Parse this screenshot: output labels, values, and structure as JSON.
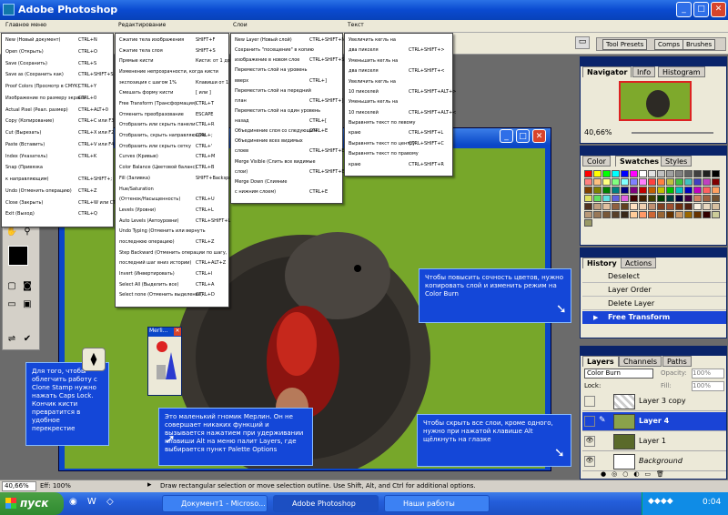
{
  "window": {
    "title": "Adobe Photoshop"
  },
  "menu_labels": [
    "Главное меню",
    "Редактирование",
    "Слои",
    "Текст"
  ],
  "palette_well": {
    "tabs": [
      "Tool Presets",
      "Comps",
      "Brushes"
    ]
  },
  "menu_file": {
    "rows": [
      {
        "label": "New (Новый документ)",
        "shortcut": "CTRL+N"
      },
      {
        "label": "Open (Открыть)",
        "shortcut": "CTRL+O"
      },
      {
        "label": "Save (Сохранить)",
        "shortcut": "CTRL+S"
      },
      {
        "label": "Save as (Сохранить как)",
        "shortcut": "CTRL+SHIFT+S"
      },
      {
        "label": "Proof Colors (Просмотр в CMYK)",
        "shortcut": "CTRL+Y"
      },
      {
        "label": "Изображение по размеру экрана",
        "shortcut": "CTRL+0"
      },
      {
        "label": "Actual Pixel (Реал. размер)",
        "shortcut": "CTRL+ALT+0"
      },
      {
        "label": "Copy (Копирование)",
        "shortcut": "CTRL+С или F3"
      },
      {
        "label": "Cut (Вырезать)",
        "shortcut": "CTRL+X или F2"
      },
      {
        "label": "Paste (Вставить)",
        "shortcut": "CTRL+V или F4"
      },
      {
        "label": "Index (Указатель)",
        "shortcut": "CTRL+K"
      },
      {
        "label": "Snap (Привязка",
        "shortcut": ""
      },
      {
        "label": "к направляющим)",
        "shortcut": "CTRL+SHIFT+;"
      },
      {
        "label": "Undo (Отменить операцию)",
        "shortcut": "CTRL+Z"
      },
      {
        "label": "Close (Закрыть)",
        "shortcut": "CTRL+W или CTRL+F4"
      },
      {
        "label": "Exit (Выход)",
        "shortcut": "CTRL+Q"
      }
    ]
  },
  "menu_edit": {
    "rows": [
      {
        "label": "Сжатие тела изображения",
        "shortcut": "SHIFT+F"
      },
      {
        "label": "Сжатие тела слоя",
        "shortcut": "SHIFT+S"
      },
      {
        "label": "Прямые кисти",
        "shortcut": "Кисти: от 1 до 9 + цифры"
      },
      {
        "label": "Изменение непрозрачности, когда кисти",
        "shortcut": ""
      },
      {
        "label": "экспозиция с шагом 1%",
        "shortcut": "Клавиши от 1 до 0"
      },
      {
        "label": "Смешать форму кисти",
        "shortcut": "[ или ]"
      },
      {
        "label": "Free Transform (Трансформация)",
        "shortcut": "CTRL+T"
      },
      {
        "label": "Отменить преобразование",
        "shortcut": "ESCAPE"
      },
      {
        "label": "Отобразить или скрыть панели",
        "shortcut": "CTRL+R"
      },
      {
        "label": "Отобразить, скрыть направляющие",
        "shortcut": "CTRL+;"
      },
      {
        "label": "Отобразить или скрыть сетку",
        "shortcut": "CTRL+'"
      },
      {
        "label": "Curves (Кривые)",
        "shortcut": "CTRL+M"
      },
      {
        "label": "Color Balance (Цветовой баланс)",
        "shortcut": "CTRL+B"
      },
      {
        "label": "Fill (Заливка)",
        "shortcut": "SHIFT+Backspace"
      },
      {
        "label": "Hue/Saturation",
        "shortcut": ""
      },
      {
        "label": "(Оттенок/Насыщенность)",
        "shortcut": "CTRL+U"
      },
      {
        "label": "Levels (Уровни)",
        "shortcut": "CTRL+L"
      },
      {
        "label": "Auto Levels (Автоуровни)",
        "shortcut": "CTRL+SHIFT+L"
      },
      {
        "label": "Undo Typing (Отменить или вернуть",
        "shortcut": ""
      },
      {
        "label": "последнюю операцию)",
        "shortcut": "CTRL+Z"
      },
      {
        "label": "Step Backward (Отменить операции по шагу,",
        "shortcut": ""
      },
      {
        "label": "последний шаг вниз истории)",
        "shortcut": "CTRL+ALT+Z"
      },
      {
        "label": "Invert (Инвертировать)",
        "shortcut": "CTRL+I"
      },
      {
        "label": "Select All (Выделить все)",
        "shortcut": "CTRL+A"
      },
      {
        "label": "Select none (Отменить выделение)",
        "shortcut": "CTRL+D"
      }
    ]
  },
  "menu_layer": {
    "rows": [
      {
        "label": "New Layer (Новый слой)",
        "shortcut": "CTRL+SHIFT+N"
      },
      {
        "label": "Сохранить \"посещение\" в копию",
        "shortcut": ""
      },
      {
        "label": "изображение в новом слое",
        "shortcut": "CTRL+SHIFT+S"
      },
      {
        "label": "Переместить слой на уровень",
        "shortcut": ""
      },
      {
        "label": "вверх",
        "shortcut": "CTRL+]"
      },
      {
        "label": "Переместить слой на передний",
        "shortcut": ""
      },
      {
        "label": "план",
        "shortcut": "CTRL+SHIFT+]"
      },
      {
        "label": "Переместить слой на один уровень",
        "shortcut": ""
      },
      {
        "label": "назад",
        "shortcut": "CTRL+["
      },
      {
        "label": "Объединение слоя со следующим",
        "shortcut": "CTRL+E"
      },
      {
        "label": "Объединение всех видимых",
        "shortcut": ""
      },
      {
        "label": "слоев",
        "shortcut": "CTRL+SHIFT+E"
      },
      {
        "label": "Merge Visible (Слить все видимые",
        "shortcut": ""
      },
      {
        "label": "слои)",
        "shortcut": "CTRL+SHIFT+E"
      },
      {
        "label": "Merge Down (Слияние",
        "shortcut": ""
      },
      {
        "label": "с нижним слоем)",
        "shortcut": "CTRL+E"
      }
    ]
  },
  "menu_text": {
    "rows": [
      {
        "label": "Увеличить кегль на",
        "shortcut": ""
      },
      {
        "label": "два пикселя",
        "shortcut": "CTRL+SHIFT+>"
      },
      {
        "label": "Уменьшить кегль на",
        "shortcut": ""
      },
      {
        "label": "два пикселя",
        "shortcut": "CTRL+SHIFT+<"
      },
      {
        "label": "Увеличить кегль на",
        "shortcut": ""
      },
      {
        "label": "10 пикселей",
        "shortcut": "CTRL+SHIFT+ALT+>"
      },
      {
        "label": "Уменьшить кегль на",
        "shortcut": ""
      },
      {
        "label": "10 пикселей",
        "shortcut": "CTRL+SHIFT+ALT+<"
      },
      {
        "label": "Выравнять текст по левому",
        "shortcut": ""
      },
      {
        "label": "краю",
        "shortcut": "CTRL+SHIFT+L"
      },
      {
        "label": "Выравнять текст по центру",
        "shortcut": "CTRL+SHIFT+C"
      },
      {
        "label": "Выравнять текст по правому",
        "shortcut": ""
      },
      {
        "label": "краю",
        "shortcut": "CTRL+SHIFT+R"
      }
    ]
  },
  "merlin": {
    "title": "Merli..."
  },
  "navigator": {
    "tabs": [
      "Navigator",
      "Info",
      "Histogram"
    ],
    "zoom": "40,66%"
  },
  "swatches": {
    "tabs": [
      "Color",
      "Swatches",
      "Styles"
    ],
    "colors": [
      "#ff0000",
      "#ffff00",
      "#00ff00",
      "#00ffff",
      "#0000ff",
      "#ff00ff",
      "#ffffff",
      "#e0e0e0",
      "#c0c0c0",
      "#a0a0a0",
      "#808080",
      "#606060",
      "#404040",
      "#202020",
      "#000000",
      "#ff8080",
      "#ffc080",
      "#ffff80",
      "#80ff80",
      "#80ffff",
      "#8080ff",
      "#ff80ff",
      "#ff4040",
      "#ff8040",
      "#c0c040",
      "#40c040",
      "#40c0c0",
      "#4040c0",
      "#c040c0",
      "#800000",
      "#804000",
      "#808000",
      "#008000",
      "#008080",
      "#000080",
      "#800080",
      "#c00000",
      "#c06000",
      "#c0c000",
      "#00c000",
      "#00c0c0",
      "#0000c0",
      "#c000c0",
      "#ff6060",
      "#ffa060",
      "#e0e060",
      "#60e060",
      "#60e0e0",
      "#6060e0",
      "#e060e0",
      "#400000",
      "#402000",
      "#404000",
      "#004000",
      "#004040",
      "#000040",
      "#400040",
      "#d08060",
      "#a06040",
      "#705030",
      "#503020",
      "#c0a080",
      "#e0c0a0",
      "#906040",
      "#604020",
      "#ffe0c0",
      "#f0d0b0",
      "#c09070",
      "#804020",
      "#a05030",
      "#703010",
      "#502010",
      "#f8f0e0",
      "#e8d8c0",
      "#d8c0a0",
      "#b89878",
      "#987858",
      "#785838",
      "#584028",
      "#382818",
      "#ffcc99",
      "#ff9966",
      "#cc6633",
      "#996633",
      "#663300",
      "#cc9966",
      "#996600",
      "#663300",
      "#330000",
      "#cccc99",
      "#999966"
    ]
  },
  "history": {
    "tabs": [
      "History",
      "Actions"
    ],
    "items": [
      "Deselect",
      "Layer Order",
      "Delete Layer",
      "Free Transform"
    ]
  },
  "layers": {
    "tabs": [
      "Layers",
      "Channels",
      "Paths"
    ],
    "blend_mode": "Color Burn",
    "opacity_label": "Opacity:",
    "opacity_value": "100%",
    "lock_label": "Lock:",
    "fill_label": "Fill:",
    "fill_value": "100%",
    "items": [
      "Layer 3 copy",
      "Layer 4",
      "Layer 1",
      "Background"
    ]
  },
  "callouts": {
    "saturation": "Чтобы повысить сочность цветов, нужно копировать слой и изменить режим на Color Burn",
    "hide_layers": "Чтобы скрыть все слои, кроме одного, нужно при нажатой клавише Alt щёлкнуть на глазке",
    "merlin": "Это маленький гномик Мерлин. Он не совершает никаких функций и вызывается нажатием при удерживании клавиши Alt на меню палит Layers, где выбирается пункт Palette Options",
    "clone": "Для того, чтобы облегчить работу с Clone Stamp нужно нажать Caps Lock. Кончик кисти превратится в удобное перекрестие"
  },
  "status": {
    "zoom": "40,66%",
    "eff": "Eff: 100%",
    "hint": "Draw rectangular selection or move selection outline.  Use Shift, Alt, and Ctrl for additional options."
  },
  "taskbar": {
    "start": "пуск",
    "tasks": [
      "Документ1 - Microso...",
      "Adobe Photoshop",
      "Наши работы"
    ],
    "clock": "0:04"
  }
}
